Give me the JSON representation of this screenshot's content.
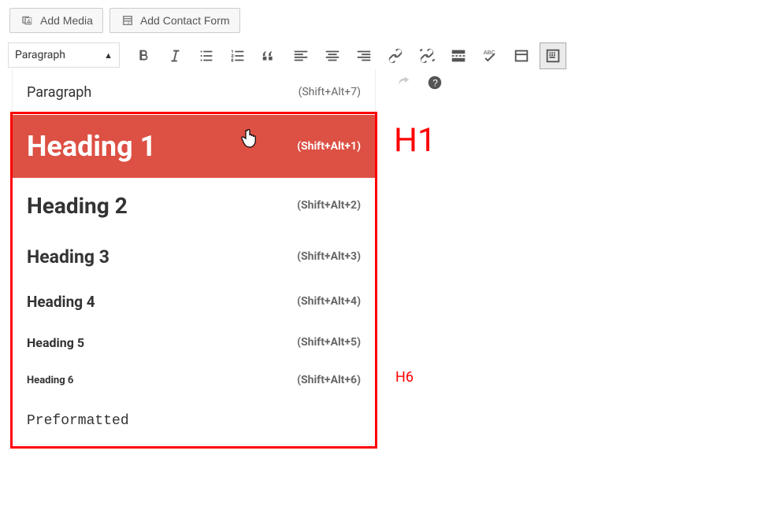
{
  "topButtons": {
    "addMedia": "Add Media",
    "addContactForm": "Add Contact Form"
  },
  "formatSelect": {
    "label": "Paragraph"
  },
  "dropdown": {
    "items": [
      {
        "label": "Paragraph",
        "shortcut": "(Shift+Alt+7)",
        "cls": "dd-p"
      },
      {
        "label": "Heading 1",
        "shortcut": "(Shift+Alt+1)",
        "cls": "dd-h1",
        "hover": true
      },
      {
        "label": "Heading 2",
        "shortcut": "(Shift+Alt+2)",
        "cls": "dd-h2"
      },
      {
        "label": "Heading 3",
        "shortcut": "(Shift+Alt+3)",
        "cls": "dd-h3"
      },
      {
        "label": "Heading 4",
        "shortcut": "(Shift+Alt+4)",
        "cls": "dd-h4"
      },
      {
        "label": "Heading 5",
        "shortcut": "(Shift+Alt+5)",
        "cls": "dd-h5"
      },
      {
        "label": "Heading 6",
        "shortcut": "(Shift+Alt+6)",
        "cls": "dd-h6"
      },
      {
        "label": "Preformatted",
        "shortcut": "",
        "cls": "dd-pre"
      }
    ]
  },
  "annotations": {
    "h1": "H1",
    "h6": "H6"
  }
}
